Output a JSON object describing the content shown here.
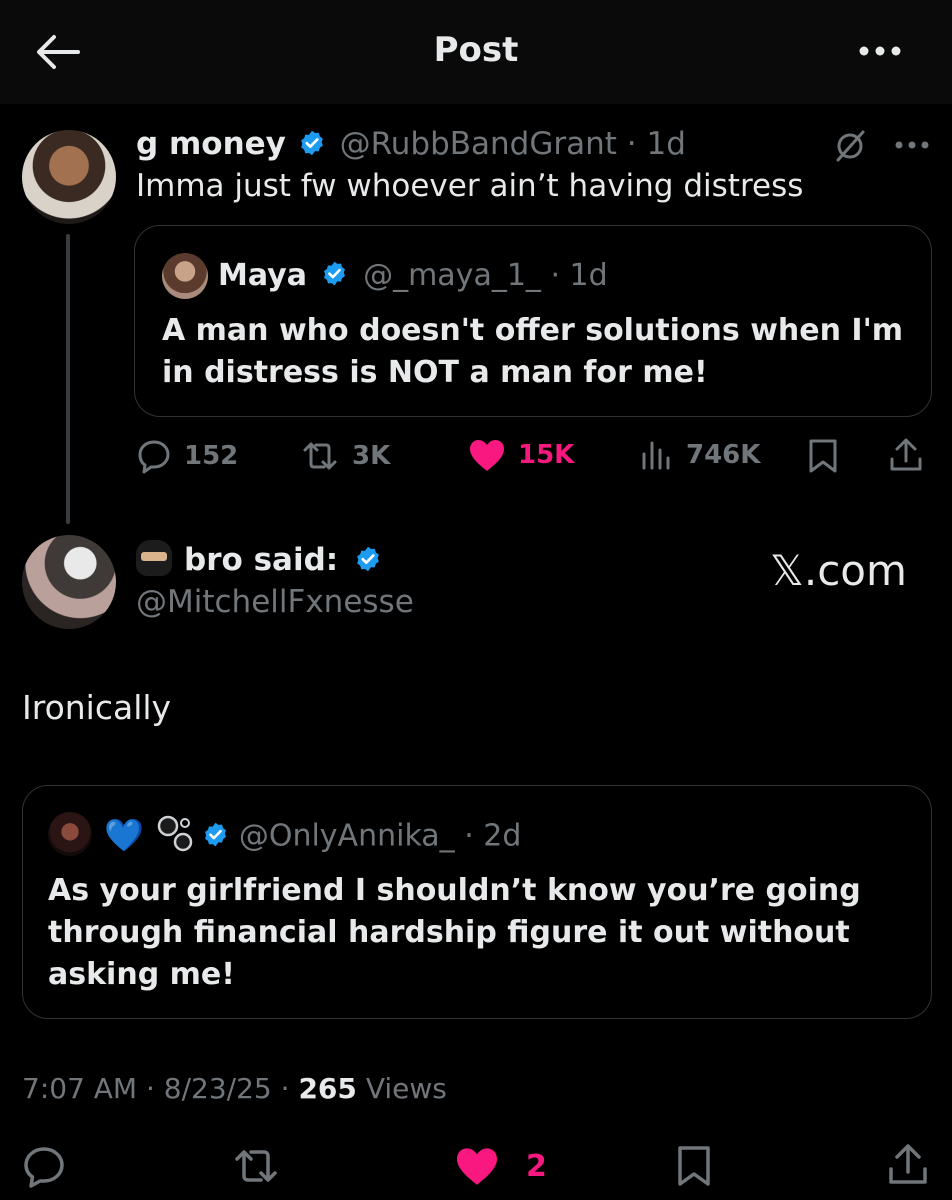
{
  "header": {
    "title": "Post"
  },
  "quoted_post": {
    "display_name": "g money",
    "handle": "@RubbBandGrant",
    "time": "· 1d",
    "text": "Imma just fw whoever ain’t having distress",
    "inner_quote": {
      "display_name": "Maya",
      "handle": "@_maya_1_",
      "time": "· 1d",
      "text": "A man who doesn't offer solutions when I'm in distress is NOT a man for me!"
    },
    "stats": {
      "replies": "152",
      "reposts": "3K",
      "likes": "15K",
      "views": "746K"
    }
  },
  "main_post": {
    "display_name": "bro said:",
    "handle": "@MitchellFxnesse",
    "watermark": "𝕏.com",
    "text": "Ironically",
    "quote": {
      "display_name_emojis": "💙",
      "handle": "@OnlyAnnika_",
      "time": "· 2d",
      "text": "As your girlfriend I shouldn’t know you’re going through financial hardship figure it out without asking me!"
    },
    "meta": {
      "time": "7:07 AM",
      "date": "· 8/23/25 ·",
      "views_count": "265",
      "views_label": "Views"
    },
    "stats": {
      "likes": "2"
    }
  },
  "colors": {
    "accent": "#1d9bf0",
    "like": "#f91880",
    "muted": "#71767b",
    "background": "#000000"
  }
}
